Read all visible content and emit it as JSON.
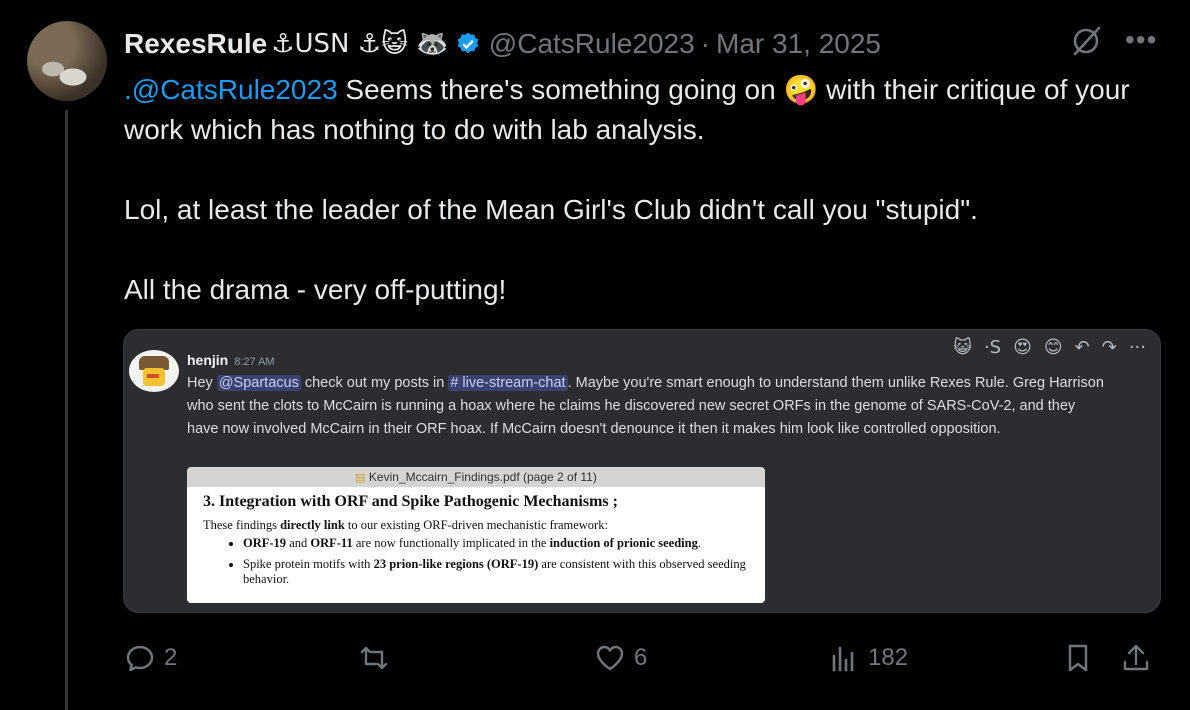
{
  "author": {
    "name": "RexesRule",
    "name_suffix": "⚓USN ⚓😺 🦝",
    "handle": "@CatsRule2023",
    "separator": "·",
    "date": "Mar 31, 2025"
  },
  "tweet": {
    "mention": ".@CatsRule2023",
    "line1": " Seems there's something going on ",
    "emoji": "🤪",
    "line1b": " with their critique of your work which has nothing to do with lab analysis.",
    "para2": "Lol, at least the leader of the Mean Girl's Club didn't call you \"stupid\".",
    "para3": "All the drama - very off-putting!"
  },
  "embedded": {
    "reactions": [
      "😺",
      "·S",
      "😍",
      "😊",
      "↶",
      "↷",
      "···"
    ],
    "username": "henjin",
    "time": "8:27 AM",
    "text_hey": "Hey ",
    "mention_user": "@Spartacus",
    "text_mid": " check out my posts in ",
    "mention_channel": "# live-stream-chat",
    "text_rest": ". Maybe you're smart enough to understand them unlike Rexes Rule. Greg Harrison who sent the clots to McCairn is running a hoax where he claims he discovered new secret ORFs in the genome of SARS-CoV-2, and they have now involved McCairn in their ORF hoax. If McCairn doesn't denounce it then it makes him look like controlled opposition.",
    "pdf": {
      "title": "Kevin_Mccairn_Findings.pdf (page 2 of 11)",
      "heading": "3. Integration with ORF and Spike Pathogenic Mechanisms ;",
      "intro_a": "These findings ",
      "intro_b": "directly link",
      "intro_c": " to our existing ORF-driven mechanistic framework:",
      "b1_a": "ORF-19",
      "b1_b": " and ",
      "b1_c": "ORF-11",
      "b1_d": " are now functionally implicated in the ",
      "b1_e": "induction of prionic seeding",
      "b1_f": ".",
      "b2_a": "Spike protein motifs with ",
      "b2_b": "23 prion-like regions (ORF-19)",
      "b2_c": " are consistent with this observed seeding behavior."
    }
  },
  "actions": {
    "replies": "2",
    "reposts": "",
    "likes": "6",
    "views": "182"
  },
  "colors": {
    "background": "#000000",
    "text": "#e7e9ea",
    "muted": "#71767b",
    "accent": "#1d9bf0",
    "embed_bg": "#2b2d31"
  }
}
